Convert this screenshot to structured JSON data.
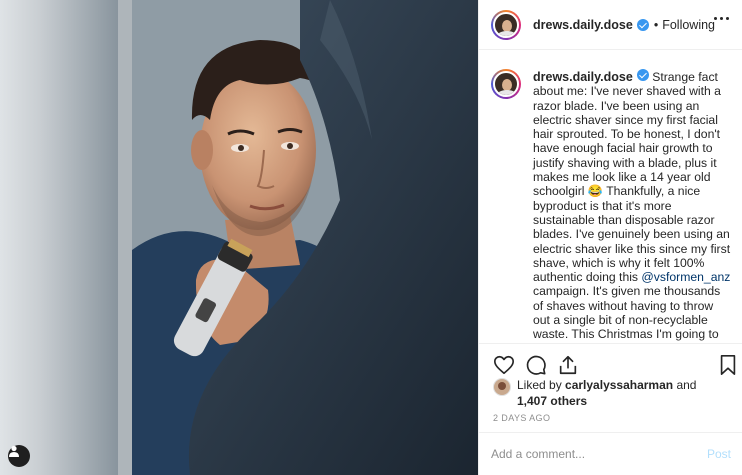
{
  "post": {
    "username": "drews.daily.dose",
    "separator": "•",
    "follow_status": "Following",
    "caption_before_mention": "Strange fact about me: I've never shaved with a razor blade. I've been using an electric shaver since my first facial hair sprouted. To be honest, I don't have enough facial hair growth to justify shaving with a blade, plus it makes me look like a 14 year old schoolgirl 😂 Thankfully, a nice byproduct is that it's more sustainable than disposable razor blades. I've genuinely been using an electric shaver like this since my first shave, which is why it felt 100% authentic doing this ",
    "mention": "@vsformen_anz",
    "caption_after_mention": " campaign. It's given me thousands of shaves without having to throw out a single bit of non-recyclable waste. This Christmas I'm going to be more",
    "liked_by_prefix": "Liked by ",
    "liked_by_user": "carlyalyssaharman",
    "liked_by_and": " and ",
    "liked_by_count": "1,407 others",
    "timestamp": "2 DAYS AGO",
    "comment_placeholder": "Add a comment...",
    "post_button": "Post"
  },
  "icons": {
    "more": "more-horizontal-icon",
    "like": "heart-icon",
    "comment": "comment-bubble-icon",
    "share": "share-arrow-icon",
    "save": "bookmark-icon",
    "tag": "user-tag-icon",
    "verified": "verified-badge-icon"
  },
  "colors": {
    "verified": "#3897f0",
    "mention": "#003569",
    "post_button_disabled": "#b2dffc",
    "muted": "#8e8e8e"
  }
}
